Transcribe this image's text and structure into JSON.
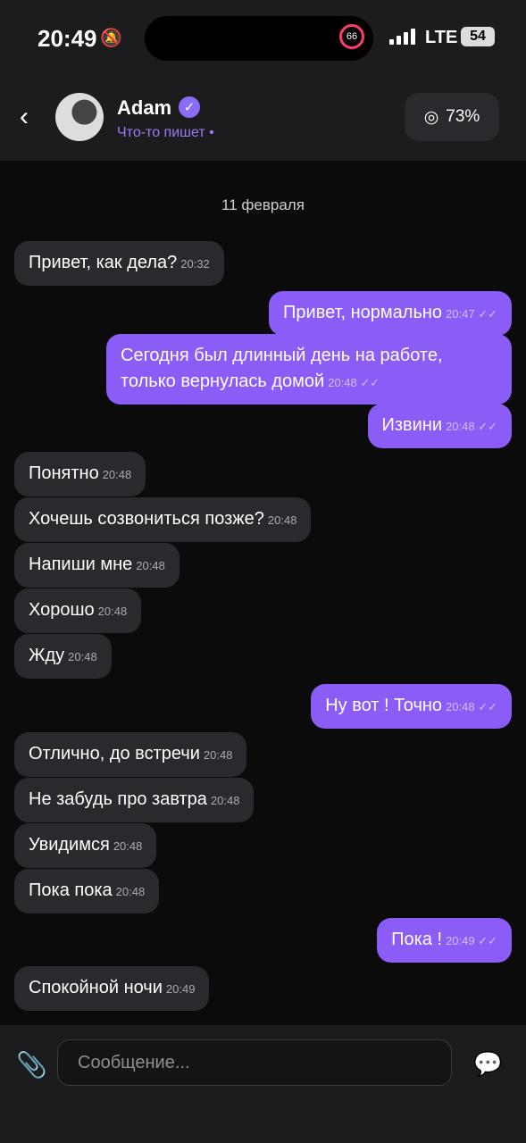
{
  "status": {
    "time": "20:49",
    "ring": "66",
    "network": "LTE",
    "battery": "54"
  },
  "header": {
    "name": "Adam",
    "status": "Что-то пишет •",
    "percent": "73%"
  },
  "chat": {
    "date": "11 февраля",
    "messages": [
      {
        "dir": "in",
        "text": "Привет, как дела?",
        "time": "20:32"
      },
      {
        "dir": "out",
        "text": "Привет, нормально",
        "time": "20:47"
      },
      {
        "dir": "out",
        "text": "Сегодня был длинный день на работе, только вернулась домой",
        "time": "20:48"
      },
      {
        "dir": "out",
        "text": "Извини",
        "time": "20:48"
      },
      {
        "dir": "in",
        "text": "Понятно",
        "time": "20:48"
      },
      {
        "dir": "in",
        "text": "Хочешь созвониться позже?",
        "time": "20:48"
      },
      {
        "dir": "in",
        "text": "Напиши мне",
        "time": "20:48"
      },
      {
        "dir": "in",
        "text": "Хорошо",
        "time": "20:48"
      },
      {
        "dir": "in",
        "text": "Жду",
        "time": "20:48"
      },
      {
        "dir": "out",
        "text": "Ну вот ! Точно",
        "time": "20:48"
      },
      {
        "dir": "in",
        "text": "Отлично, до встречи",
        "time": "20:48"
      },
      {
        "dir": "in",
        "text": "Не забудь про завтра",
        "time": "20:48"
      },
      {
        "dir": "in",
        "text": "Увидимся",
        "time": "20:48"
      },
      {
        "dir": "in",
        "text": "Пока пока",
        "time": "20:48"
      },
      {
        "dir": "out",
        "text": "Пока !",
        "time": "20:49"
      },
      {
        "dir": "in",
        "text": "Спокойной ночи",
        "time": "20:49"
      }
    ]
  },
  "composer": {
    "placeholder": "Сообщение..."
  }
}
